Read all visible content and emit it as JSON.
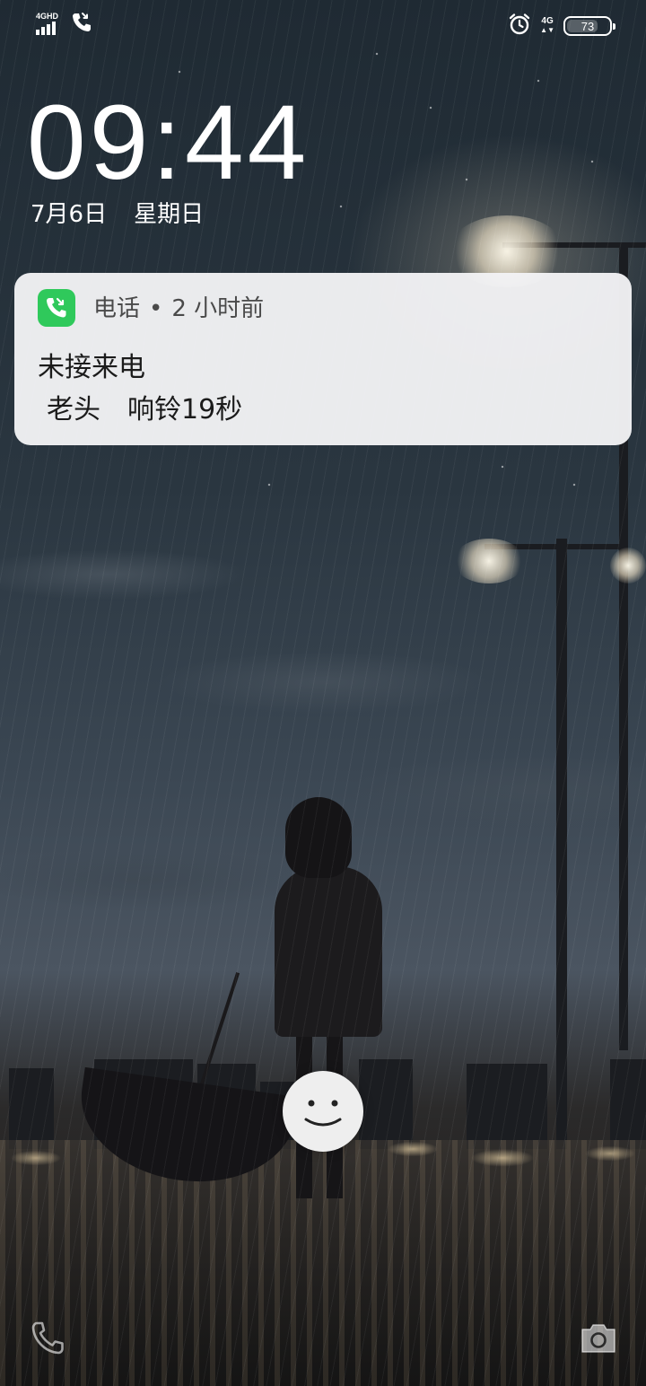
{
  "status_bar": {
    "network_label": "4GHD",
    "data_label": "4G",
    "battery_level": "73",
    "battery_fraction": 0.73
  },
  "lock_screen": {
    "time": "09:44",
    "date": "7月6日",
    "weekday": "星期日"
  },
  "notification": {
    "app_name": "电话",
    "separator": "•",
    "time_ago": "2 小时前",
    "title": "未接来电",
    "caller": "老头",
    "detail": "响铃19秒",
    "accent_color": "#2fc95b"
  },
  "icons": {
    "missed_call_status": "missed-call-icon",
    "alarm": "alarm-clock-icon",
    "phone_shortcut": "phone-icon",
    "camera_shortcut": "camera-icon",
    "unlock": "smiley-unlock-icon"
  }
}
